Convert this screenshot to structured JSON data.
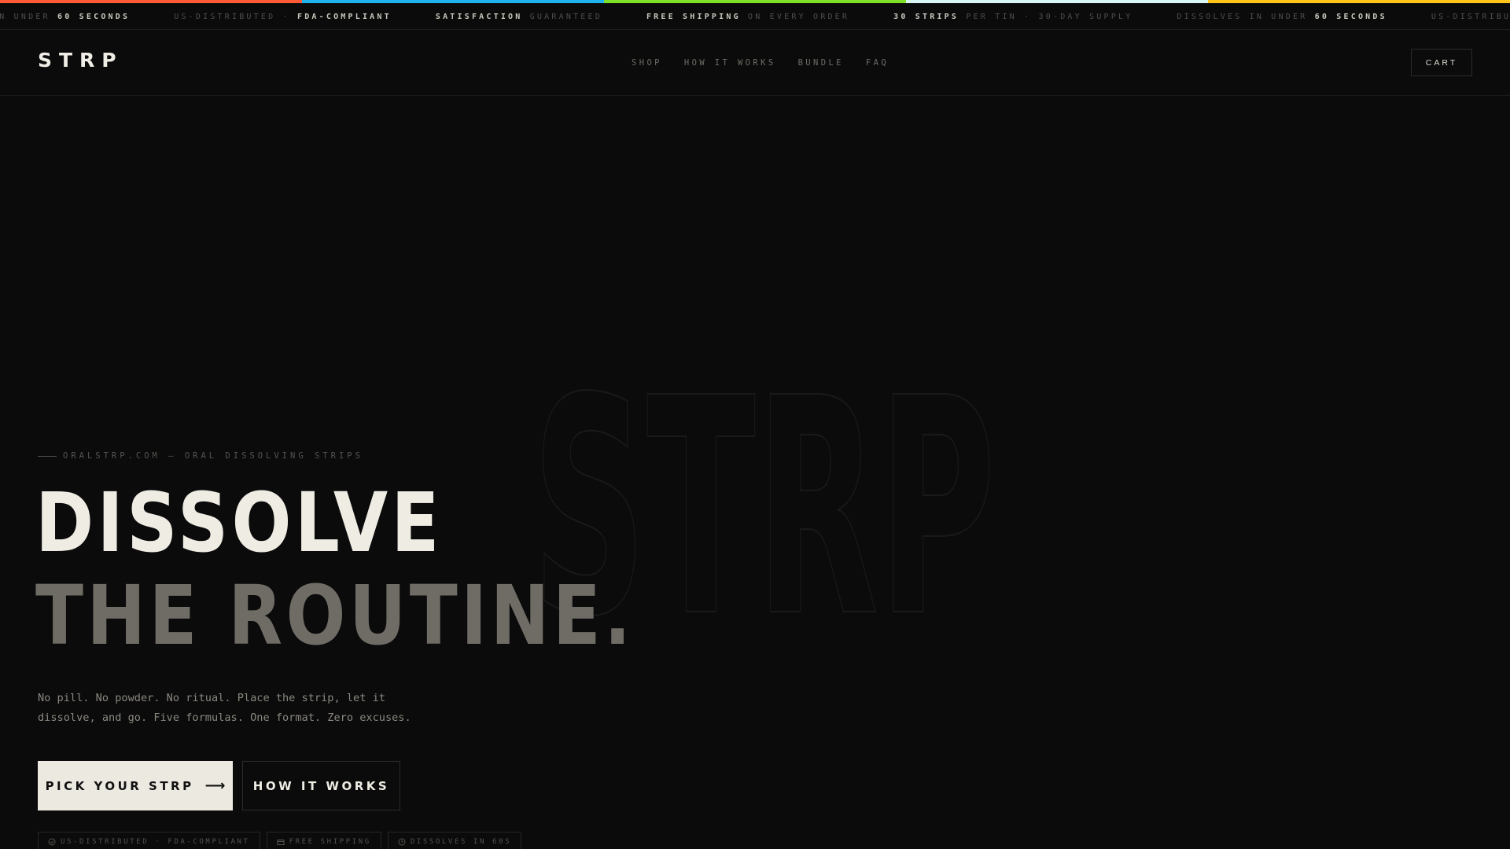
{
  "colors": {
    "strip": [
      "#ff5a36",
      "#1fb3ee",
      "#7fe02a",
      "#d8f6f4",
      "#ffc61a"
    ],
    "background": "#0b0b0b",
    "text_primary": "#efece4",
    "text_muted": "#6f6c66"
  },
  "ticker": {
    "items": [
      {
        "normal_a": "IN UNDER ",
        "bold": "60 SECONDS",
        "normal_b": ""
      },
      {
        "normal_a": "US-DISTRIBUTED · ",
        "bold": "FDA-COMPLIANT",
        "normal_b": ""
      },
      {
        "normal_a": "",
        "bold": "SATISFACTION",
        "normal_b": " GUARANTEED"
      },
      {
        "normal_a": "",
        "bold": "FREE SHIPPING",
        "normal_b": " ON EVERY ORDER"
      },
      {
        "normal_a": "",
        "bold": "30 STRIPS",
        "normal_b": " PER TIN · 30-DAY SUPPLY"
      },
      {
        "normal_a": "DISSOLVES IN UNDER ",
        "bold": "60 SECONDS",
        "normal_b": ""
      },
      {
        "normal_a": "US-DISTRIBUTED · ",
        "bold": "FDA-COMPLIANT",
        "normal_b": ""
      }
    ]
  },
  "header": {
    "logo": "STRP",
    "nav": [
      "SHOP",
      "HOW IT WORKS",
      "BUNDLE",
      "FAQ"
    ],
    "cart_label": "CART"
  },
  "hero": {
    "watermark": "STRP",
    "eyebrow": "ORALSTRP.COM — ORAL DISSOLVING STRIPS",
    "headline_line1": "DISSOLVE",
    "headline_line2": "THE ROUTINE.",
    "subcopy_line1": "No pill. No powder. No ritual. Place the strip, let it",
    "subcopy_line2": "dissolve, and go. Five formulas. One format. Zero excuses.",
    "primary_cta": "PICK YOUR STRP",
    "primary_cta_arrow": "⟶",
    "secondary_cta": "HOW IT WORKS",
    "badges": [
      {
        "icon": "check-circle-icon",
        "label": "US-DISTRIBUTED · FDA-COMPLIANT"
      },
      {
        "icon": "box-icon",
        "label": "FREE SHIPPING"
      },
      {
        "icon": "clock-icon",
        "label": "DISSOLVES IN 60S"
      }
    ]
  }
}
